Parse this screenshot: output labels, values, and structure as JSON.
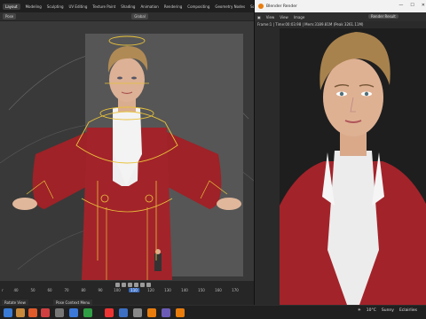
{
  "left_window": {
    "tabs": [
      "Layout",
      "Modeling",
      "Sculpting",
      "UV Editing",
      "Texture Paint",
      "Shading",
      "Animation",
      "Rendering",
      "Compositing",
      "Geometry Nodes",
      "Scripting"
    ],
    "tool_mode": "Pose",
    "transform_orientation": "Global",
    "timeline": {
      "tick_labels": [
        "40",
        "50",
        "60",
        "70",
        "80",
        "90",
        "100",
        "110",
        "120",
        "130",
        "140",
        "150",
        "160",
        "170"
      ],
      "current_frame": "110",
      "start_label": "r"
    },
    "status_left": "Rotate View",
    "status_mid": "Pose Context Menu"
  },
  "render_window": {
    "title": "Blender Render",
    "menu": [
      "View",
      "View",
      "Image"
    ],
    "result_label": "Render Result",
    "info": "Frame:1 | Time:00:03.98 | Mem:3189.81M (Peak 3261.11M)"
  },
  "taskbar": {
    "weather": "10°C",
    "weather_desc": "Sunny",
    "time": "Eclairlies"
  },
  "colors": {
    "jacket": "#a3232a",
    "rig": "#e8c23a",
    "accent": "#3d6fc2"
  }
}
